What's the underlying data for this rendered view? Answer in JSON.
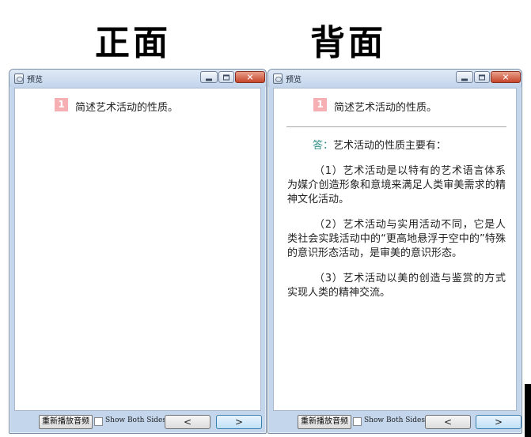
{
  "headings": {
    "front": "正面",
    "back": "背面"
  },
  "windows": {
    "front": {
      "title": "预览",
      "card_number": "1",
      "question": "简述艺术活动的性质。",
      "replay_label": "重新播放音频",
      "show_both_label": "Show Both Sides",
      "show_both_checked": false,
      "prev_glyph": "<",
      "next_glyph": ">"
    },
    "back": {
      "title": "预览",
      "card_number": "1",
      "question": "简述艺术活动的性质。",
      "answer": {
        "label": "答：",
        "intro": "艺术活动的性质主要有：",
        "paragraphs": [
          "（1）艺术活动是以特有的艺术语言体系为媒介创造形象和意境来满足人类审美需求的精神文化活动。",
          "（2）艺术活动与实用活动不同，它是人类社会实践活动中的“更高地悬浮于空中的”特殊的意识形态活动，是审美的意识形态。",
          "（3）艺术活动以美的创造与鉴赏的方式实现人类的精神交流。"
        ]
      },
      "replay_label": "重新播放音频",
      "show_both_label": "Show Both Sides",
      "show_both_checked": false,
      "prev_glyph": "<",
      "next_glyph": ">"
    }
  },
  "icons": {
    "app": "preview-app-icon",
    "minimize": "minimize-icon",
    "maximize": "maximize-icon",
    "close": "close-icon"
  },
  "colors": {
    "card_number_bg": "#f6b0b4",
    "answer_label": "#2f8f86",
    "close_button": "#c7452b",
    "window_frame": "#c3d6ec"
  }
}
